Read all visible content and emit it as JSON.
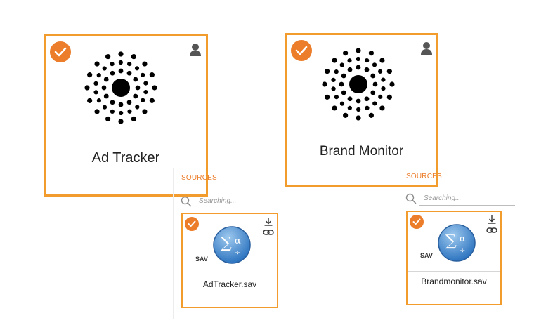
{
  "colors": {
    "accent": "#ec7d2a",
    "card_border": "#f39c2e",
    "divider": "#d6d6d6"
  },
  "projects": [
    {
      "title": "Ad Tracker",
      "selected": true,
      "icon": "user-icon"
    },
    {
      "title": "Brand Monitor",
      "selected": true,
      "icon": "user-icon"
    }
  ],
  "sources_panels": [
    {
      "label": "SOURCES",
      "search_placeholder": "Searching...",
      "file": {
        "name": "AdTracker.sav",
        "type_badge": "SAV",
        "selected": true
      }
    },
    {
      "label": "SOURCES",
      "search_placeholder": "Searching...",
      "file": {
        "name": "Brandmonitor.sav",
        "type_badge": "SAV",
        "selected": true
      }
    }
  ]
}
